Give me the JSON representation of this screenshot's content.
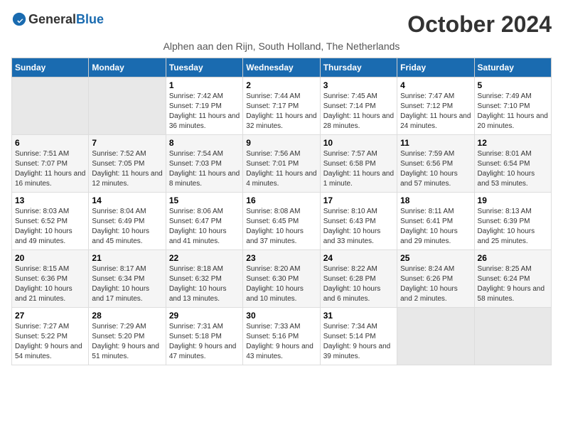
{
  "logo": {
    "text_general": "General",
    "text_blue": "Blue"
  },
  "header": {
    "month_year": "October 2024",
    "location": "Alphen aan den Rijn, South Holland, The Netherlands"
  },
  "days_of_week": [
    "Sunday",
    "Monday",
    "Tuesday",
    "Wednesday",
    "Thursday",
    "Friday",
    "Saturday"
  ],
  "weeks": [
    [
      {
        "day": "",
        "empty": true
      },
      {
        "day": "",
        "empty": true
      },
      {
        "day": "1",
        "sunrise": "Sunrise: 7:42 AM",
        "sunset": "Sunset: 7:19 PM",
        "daylight": "Daylight: 11 hours and 36 minutes."
      },
      {
        "day": "2",
        "sunrise": "Sunrise: 7:44 AM",
        "sunset": "Sunset: 7:17 PM",
        "daylight": "Daylight: 11 hours and 32 minutes."
      },
      {
        "day": "3",
        "sunrise": "Sunrise: 7:45 AM",
        "sunset": "Sunset: 7:14 PM",
        "daylight": "Daylight: 11 hours and 28 minutes."
      },
      {
        "day": "4",
        "sunrise": "Sunrise: 7:47 AM",
        "sunset": "Sunset: 7:12 PM",
        "daylight": "Daylight: 11 hours and 24 minutes."
      },
      {
        "day": "5",
        "sunrise": "Sunrise: 7:49 AM",
        "sunset": "Sunset: 7:10 PM",
        "daylight": "Daylight: 11 hours and 20 minutes."
      }
    ],
    [
      {
        "day": "6",
        "sunrise": "Sunrise: 7:51 AM",
        "sunset": "Sunset: 7:07 PM",
        "daylight": "Daylight: 11 hours and 16 minutes."
      },
      {
        "day": "7",
        "sunrise": "Sunrise: 7:52 AM",
        "sunset": "Sunset: 7:05 PM",
        "daylight": "Daylight: 11 hours and 12 minutes."
      },
      {
        "day": "8",
        "sunrise": "Sunrise: 7:54 AM",
        "sunset": "Sunset: 7:03 PM",
        "daylight": "Daylight: 11 hours and 8 minutes."
      },
      {
        "day": "9",
        "sunrise": "Sunrise: 7:56 AM",
        "sunset": "Sunset: 7:01 PM",
        "daylight": "Daylight: 11 hours and 4 minutes."
      },
      {
        "day": "10",
        "sunrise": "Sunrise: 7:57 AM",
        "sunset": "Sunset: 6:58 PM",
        "daylight": "Daylight: 11 hours and 1 minute."
      },
      {
        "day": "11",
        "sunrise": "Sunrise: 7:59 AM",
        "sunset": "Sunset: 6:56 PM",
        "daylight": "Daylight: 10 hours and 57 minutes."
      },
      {
        "day": "12",
        "sunrise": "Sunrise: 8:01 AM",
        "sunset": "Sunset: 6:54 PM",
        "daylight": "Daylight: 10 hours and 53 minutes."
      }
    ],
    [
      {
        "day": "13",
        "sunrise": "Sunrise: 8:03 AM",
        "sunset": "Sunset: 6:52 PM",
        "daylight": "Daylight: 10 hours and 49 minutes."
      },
      {
        "day": "14",
        "sunrise": "Sunrise: 8:04 AM",
        "sunset": "Sunset: 6:49 PM",
        "daylight": "Daylight: 10 hours and 45 minutes."
      },
      {
        "day": "15",
        "sunrise": "Sunrise: 8:06 AM",
        "sunset": "Sunset: 6:47 PM",
        "daylight": "Daylight: 10 hours and 41 minutes."
      },
      {
        "day": "16",
        "sunrise": "Sunrise: 8:08 AM",
        "sunset": "Sunset: 6:45 PM",
        "daylight": "Daylight: 10 hours and 37 minutes."
      },
      {
        "day": "17",
        "sunrise": "Sunrise: 8:10 AM",
        "sunset": "Sunset: 6:43 PM",
        "daylight": "Daylight: 10 hours and 33 minutes."
      },
      {
        "day": "18",
        "sunrise": "Sunrise: 8:11 AM",
        "sunset": "Sunset: 6:41 PM",
        "daylight": "Daylight: 10 hours and 29 minutes."
      },
      {
        "day": "19",
        "sunrise": "Sunrise: 8:13 AM",
        "sunset": "Sunset: 6:39 PM",
        "daylight": "Daylight: 10 hours and 25 minutes."
      }
    ],
    [
      {
        "day": "20",
        "sunrise": "Sunrise: 8:15 AM",
        "sunset": "Sunset: 6:36 PM",
        "daylight": "Daylight: 10 hours and 21 minutes."
      },
      {
        "day": "21",
        "sunrise": "Sunrise: 8:17 AM",
        "sunset": "Sunset: 6:34 PM",
        "daylight": "Daylight: 10 hours and 17 minutes."
      },
      {
        "day": "22",
        "sunrise": "Sunrise: 8:18 AM",
        "sunset": "Sunset: 6:32 PM",
        "daylight": "Daylight: 10 hours and 13 minutes."
      },
      {
        "day": "23",
        "sunrise": "Sunrise: 8:20 AM",
        "sunset": "Sunset: 6:30 PM",
        "daylight": "Daylight: 10 hours and 10 minutes."
      },
      {
        "day": "24",
        "sunrise": "Sunrise: 8:22 AM",
        "sunset": "Sunset: 6:28 PM",
        "daylight": "Daylight: 10 hours and 6 minutes."
      },
      {
        "day": "25",
        "sunrise": "Sunrise: 8:24 AM",
        "sunset": "Sunset: 6:26 PM",
        "daylight": "Daylight: 10 hours and 2 minutes."
      },
      {
        "day": "26",
        "sunrise": "Sunrise: 8:25 AM",
        "sunset": "Sunset: 6:24 PM",
        "daylight": "Daylight: 9 hours and 58 minutes."
      }
    ],
    [
      {
        "day": "27",
        "sunrise": "Sunrise: 7:27 AM",
        "sunset": "Sunset: 5:22 PM",
        "daylight": "Daylight: 9 hours and 54 minutes."
      },
      {
        "day": "28",
        "sunrise": "Sunrise: 7:29 AM",
        "sunset": "Sunset: 5:20 PM",
        "daylight": "Daylight: 9 hours and 51 minutes."
      },
      {
        "day": "29",
        "sunrise": "Sunrise: 7:31 AM",
        "sunset": "Sunset: 5:18 PM",
        "daylight": "Daylight: 9 hours and 47 minutes."
      },
      {
        "day": "30",
        "sunrise": "Sunrise: 7:33 AM",
        "sunset": "Sunset: 5:16 PM",
        "daylight": "Daylight: 9 hours and 43 minutes."
      },
      {
        "day": "31",
        "sunrise": "Sunrise: 7:34 AM",
        "sunset": "Sunset: 5:14 PM",
        "daylight": "Daylight: 9 hours and 39 minutes."
      },
      {
        "day": "",
        "empty": true
      },
      {
        "day": "",
        "empty": true
      }
    ]
  ]
}
